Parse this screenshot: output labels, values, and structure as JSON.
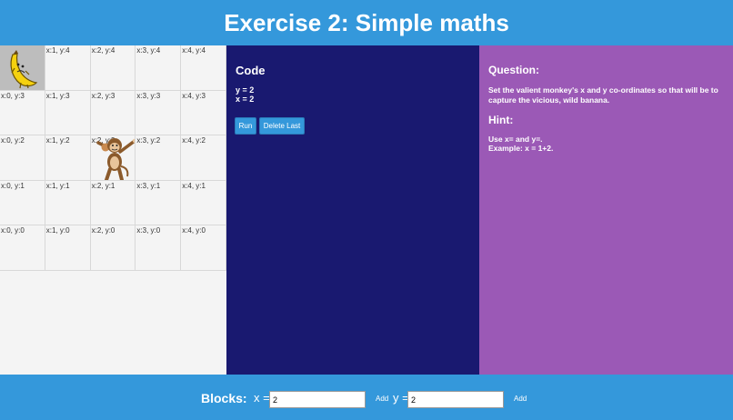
{
  "header": {
    "title": "Exercise 2: Simple maths"
  },
  "grid": {
    "rows": [
      [
        "",
        "x:1, y:4",
        "x:2, y:4",
        "x:3, y:4",
        "x:4, y:4"
      ],
      [
        "x:0, y:3",
        "x:1, y:3",
        "x:2, y:3",
        "x:3, y:3",
        "x:4, y:3"
      ],
      [
        "x:0, y:2",
        "x:1, y:2",
        "x:2, y:2",
        "x:3, y:2",
        "x:4, y:2"
      ],
      [
        "x:0, y:1",
        "x:1, y:1",
        "x:2, y:1",
        "x:3, y:1",
        "x:4, y:1"
      ],
      [
        "x:0, y:0",
        "x:1, y:0",
        "x:2, y:0",
        "x:3, y:0",
        "x:4, y:0"
      ]
    ],
    "banana_icon": "banana-icon",
    "monkey_icon": "monkey-icon"
  },
  "code": {
    "title": "Code",
    "lines": [
      "y = 2",
      "x = 2"
    ],
    "run_label": "Run",
    "delete_label": "Delete Last"
  },
  "question": {
    "title": "Question:",
    "text": "Set the valient monkey's x and y co-ordinates so that will be to capture the vicious, wild banana.",
    "hint_title": "Hint:",
    "hint_lines": [
      "Use x= and y=.",
      "Example: x = 1+2."
    ]
  },
  "footer": {
    "blocks_label": "Blocks:",
    "x_label": "x =",
    "x_value": "2",
    "y_label": "y =",
    "y_value": "2",
    "add_label": "Add"
  },
  "colors": {
    "header": "#3498db",
    "code_panel": "#191970",
    "question_panel": "#9b59b6",
    "grid_bg": "#f4f4f4"
  }
}
